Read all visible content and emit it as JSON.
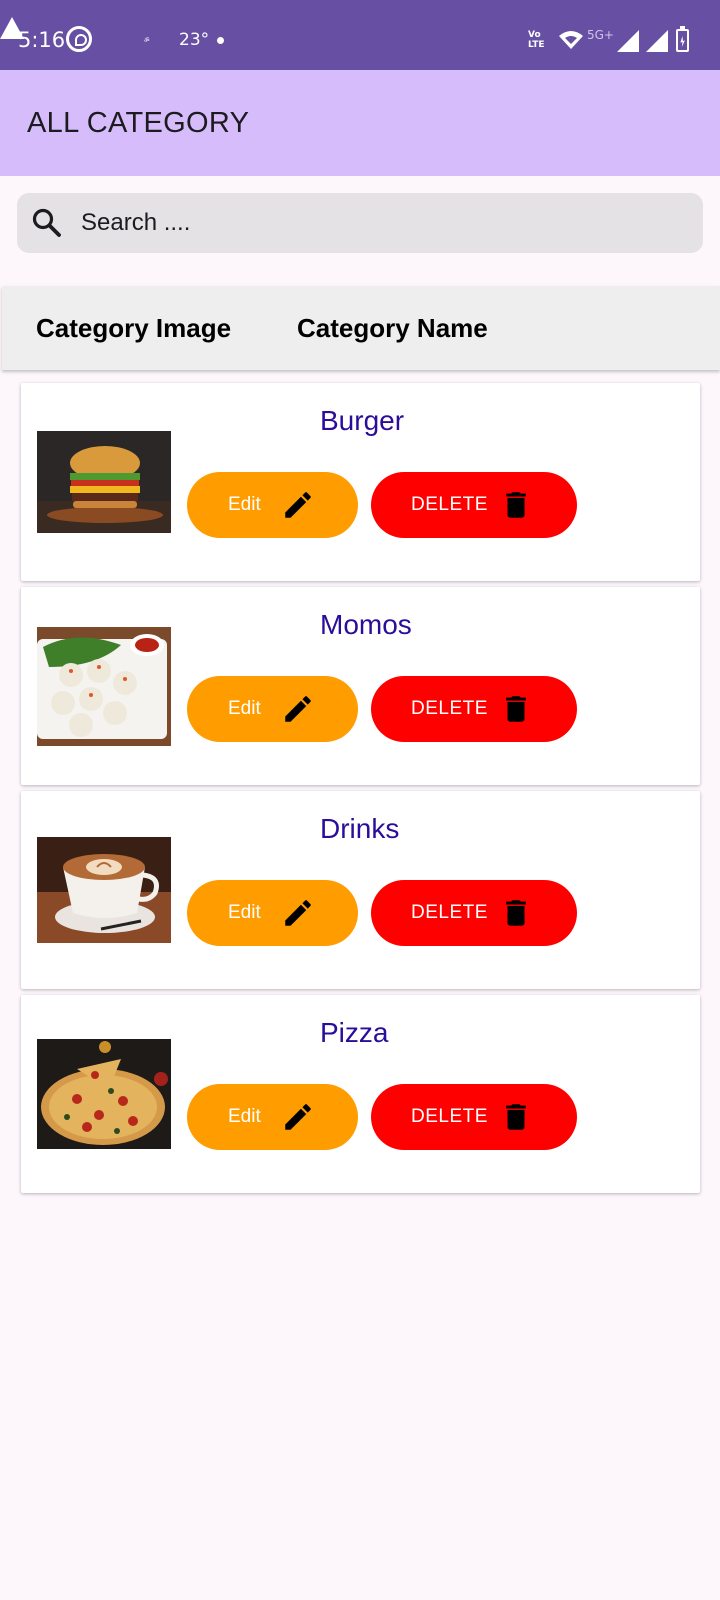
{
  "status_bar": {
    "time": "5:16",
    "small_text": "ॐ",
    "temperature": "23°",
    "volte_line1": "Vo",
    "volte_line2": "LTE",
    "network": "5G+",
    "icons": [
      "whatsapp-icon",
      "warning-icon",
      "dot-icon",
      "volte-icon",
      "wifi-icon",
      "signal-icon",
      "signal-icon",
      "battery-charging-icon"
    ]
  },
  "app_bar": {
    "title": "ALL CATEGORY"
  },
  "search": {
    "placeholder": "Search ....",
    "value": "",
    "icon": "search-icon"
  },
  "table_header": {
    "image_column": "Category Image",
    "name_column": "Category Name"
  },
  "colors": {
    "status_bar": "#6750a4",
    "app_bar": "#d6bcfa",
    "category_name": "#2a0d99",
    "edit_button": "#ff9c00",
    "delete_button": "#ff0000"
  },
  "categories": [
    {
      "name": "Burger",
      "edit_label": "Edit",
      "delete_label": "DELETE",
      "image": "burger-photo"
    },
    {
      "name": "Momos",
      "edit_label": "Edit",
      "delete_label": "DELETE",
      "image": "momos-photo"
    },
    {
      "name": "Drinks",
      "edit_label": "Edit",
      "delete_label": "DELETE",
      "image": "coffee-photo"
    },
    {
      "name": "Pizza",
      "edit_label": "Edit",
      "delete_label": "DELETE",
      "image": "pizza-photo"
    }
  ]
}
